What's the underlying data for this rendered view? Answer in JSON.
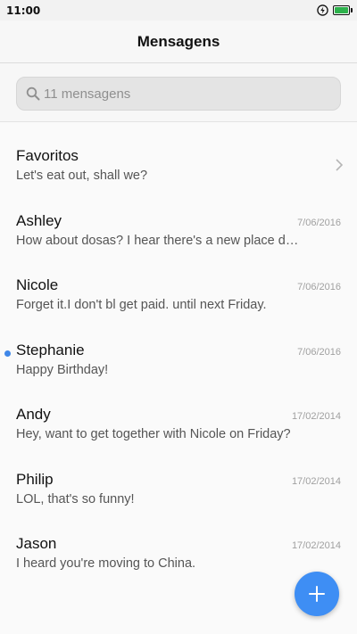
{
  "status_bar": {
    "time": "11:00",
    "icons": [
      "charging-bolt-icon",
      "battery-icon"
    ],
    "battery_color": "#2db24c"
  },
  "header": {
    "title": "Mensagens"
  },
  "search": {
    "placeholder": "11 mensagens",
    "icon": "search-icon"
  },
  "favorites": {
    "label": "Favoritos",
    "preview": "Let's eat out, shall we?",
    "icon": "chevron-right-icon"
  },
  "messages": [
    {
      "sender": "Ashley",
      "date": "7/06/2016",
      "preview": "How about dosas? I hear there's a new place do…",
      "unread": false
    },
    {
      "sender": "Nicole",
      "date": "7/06/2016",
      "preview": "Forget it.I don't bl get paid. until next Friday.",
      "unread": false
    },
    {
      "sender": "Stephanie",
      "date": "7/06/2016",
      "preview": "Happy Birthday!",
      "unread": true
    },
    {
      "sender": "Andy",
      "date": "17/02/2014",
      "preview": "Hey, want to get together with Nicole on Friday?",
      "unread": false
    },
    {
      "sender": "Philip",
      "date": "17/02/2014",
      "preview": "LOL, that's so funny!",
      "unread": false
    },
    {
      "sender": "Jason",
      "date": "17/02/2014",
      "preview": "I heard you're moving to China.",
      "unread": false
    }
  ],
  "compose_button": {
    "icon": "plus-icon",
    "color": "#3e8ef4"
  },
  "colors": {
    "accent": "#3e8ef4",
    "unread_dot": "#3f87e8"
  }
}
